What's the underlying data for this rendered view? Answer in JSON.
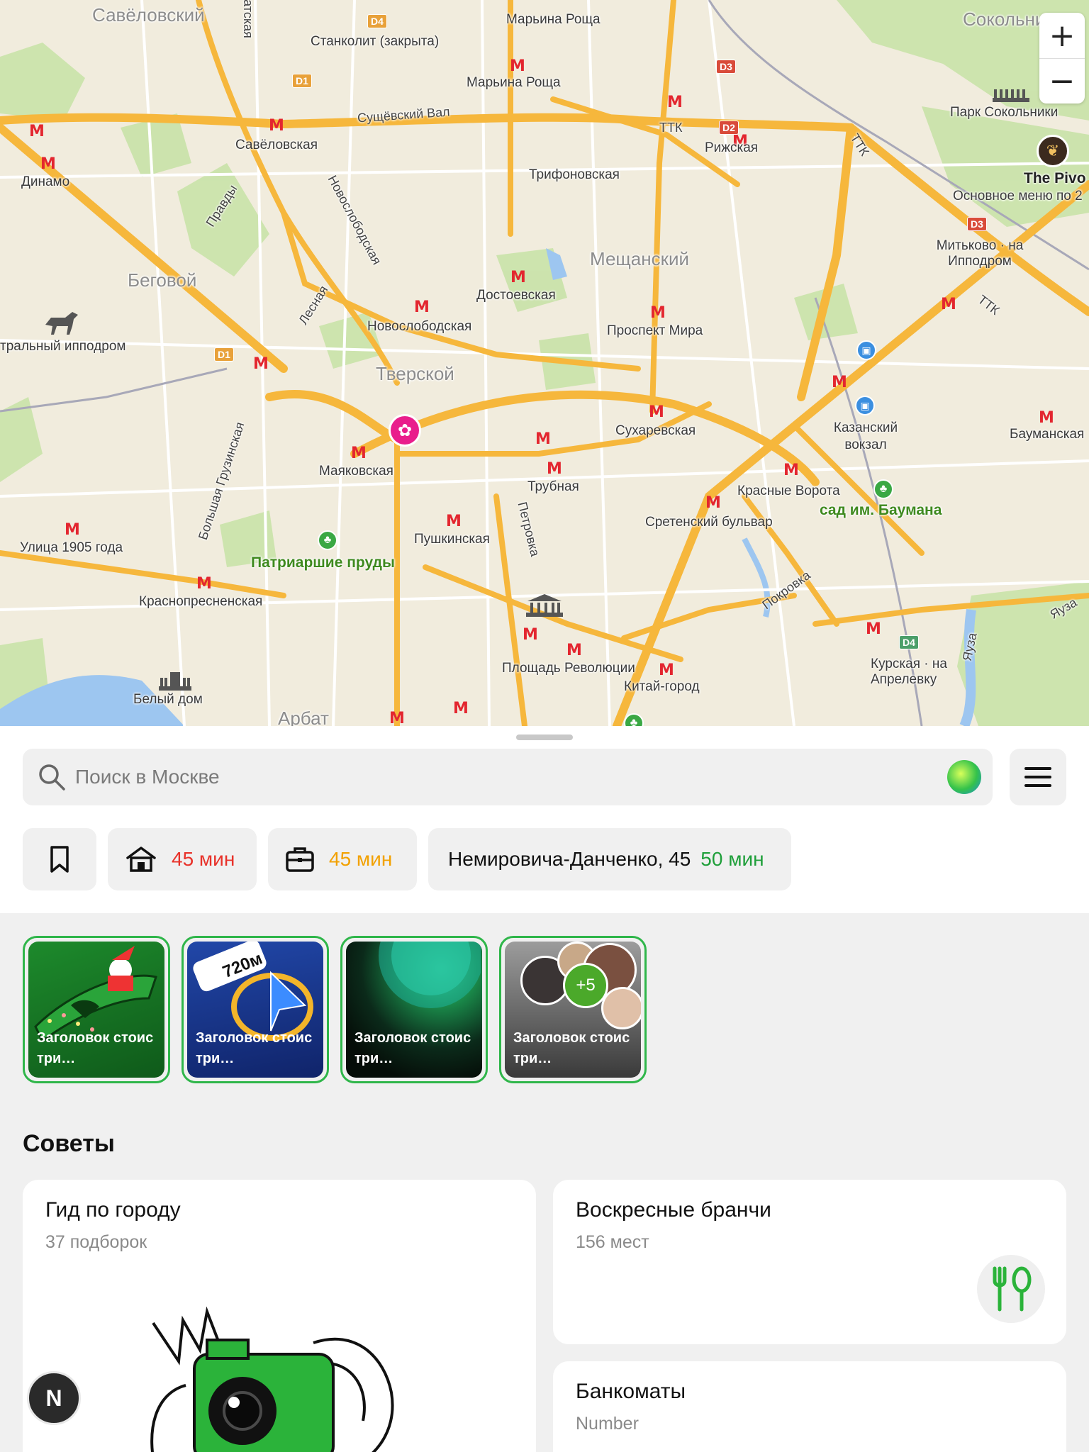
{
  "map": {
    "districts": [
      "Савёловский",
      "Беговой",
      "Тверской",
      "Мещанский",
      "Арбат",
      "Сокольники"
    ],
    "metro_stations": [
      "Марьина Роща",
      "Савёловская",
      "Динамо",
      "Рижская",
      "Трифоновская",
      "Достоевская",
      "Новослободская",
      "Проспект Мира",
      "Сухаревская",
      "Маяковская",
      "Трубная",
      "Пушкинская",
      "Улица 1905 года",
      "Краснопресненская",
      "Красные Ворота",
      "Сретенский бульвар",
      "Площадь Революции",
      "Китай-город",
      "Курская · на Апрелевку",
      "Бауманская",
      "Митьково · на Ипподром",
      "Казанский вокзал"
    ],
    "streets": [
      "Сущёвский Вал",
      "Новослободская",
      "Правды",
      "Лесная",
      "Большая Грузинская",
      "Петровка",
      "Покровка",
      "ТТК",
      "ТТК",
      "ТТК",
      "Яуза",
      "Яуза",
      "атская"
    ],
    "places": [
      "Станколит (закрыта)",
      "Парк Сокольники",
      "тральный ипподром",
      "Белый дом"
    ],
    "parks": [
      "Патриаршие пруды",
      "сад им. Баумана"
    ],
    "poi": {
      "name": "The Pivo",
      "subtitle": "Основное меню по 2"
    },
    "road_shields": [
      "D4",
      "D3",
      "D2",
      "D1",
      "D1",
      "D3",
      "D4"
    ],
    "zoom": {
      "in": "+",
      "out": "−"
    }
  },
  "search": {
    "placeholder": "Поиск в Москве"
  },
  "quick_chips": [
    {
      "icon": "bookmark-icon",
      "label": "",
      "time": ""
    },
    {
      "icon": "home-icon",
      "label": "",
      "time": "45 мин",
      "color": "#e8322a"
    },
    {
      "icon": "briefcase-icon",
      "label": "",
      "time": "45 мин",
      "color": "#f2a100"
    },
    {
      "icon": "",
      "label": "Немировича-Данченко, 45",
      "time": "50 мин",
      "color": "#1f9f3a"
    }
  ],
  "stories": [
    {
      "caption": "Заголовок стоис три…"
    },
    {
      "caption": "Заголовок стоис три…",
      "badge": "720м"
    },
    {
      "caption": "Заголовок стоис три…"
    },
    {
      "caption": "Заголовок стоис три…",
      "badge": "+5"
    }
  ],
  "tips": {
    "title": "Советы",
    "cards": [
      {
        "title": "Гид по городу",
        "subtitle": "37 подборок"
      },
      {
        "title": "Воскресные бранчи",
        "subtitle": "156 мест"
      },
      {
        "title": "Банкоматы",
        "subtitle": "Number"
      }
    ]
  },
  "floating_badge": "N",
  "colors": {
    "accent_green": "#2fb64a",
    "metro_red": "#e3262f",
    "road_yellow": "#f6b73c"
  }
}
